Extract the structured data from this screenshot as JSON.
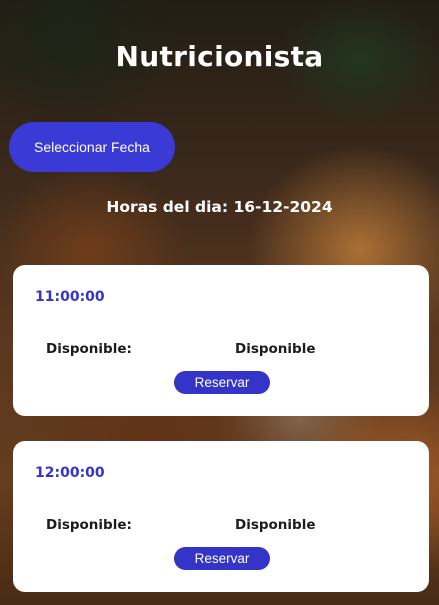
{
  "header": {
    "title": "Nutricionista"
  },
  "date_picker": {
    "button_label": "Seleccionar Fecha"
  },
  "schedule": {
    "heading": "Horas del dia: 16-12-2024",
    "slots": [
      {
        "time": "11:00:00",
        "status_label": "Disponible:",
        "status_value": "Disponible",
        "reserve_label": "Reservar"
      },
      {
        "time": "12:00:00",
        "status_label": "Disponible:",
        "status_value": "Disponible",
        "reserve_label": "Reservar"
      }
    ]
  },
  "colors": {
    "accent": "#3434c8",
    "card_background": "#ffffff",
    "title_text": "#ffffff"
  }
}
